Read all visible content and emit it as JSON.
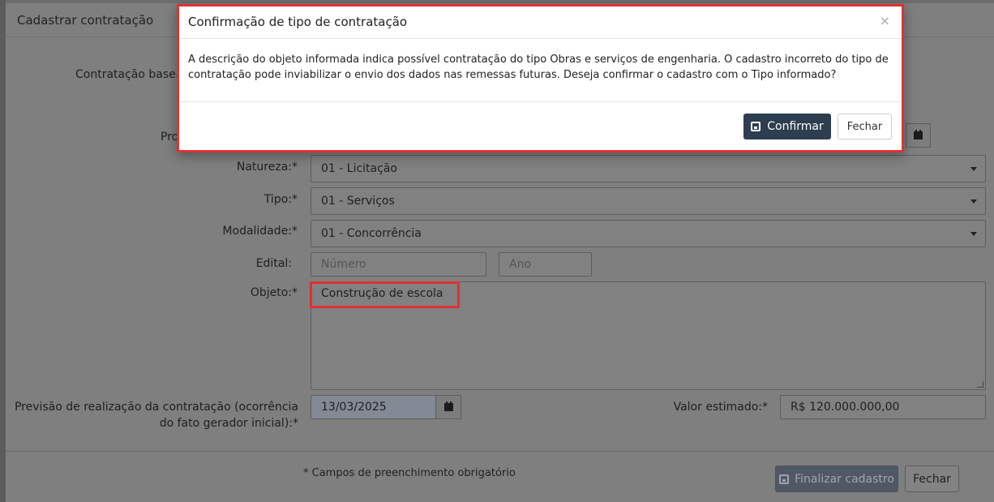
{
  "base_modal": {
    "title": "Cadastrar contratação",
    "labels": {
      "contratacao_baseada": "Contratação basea",
      "processo": "Pro",
      "natureza": "Natureza:*",
      "tipo": "Tipo:*",
      "modalidade": "Modalidade:*",
      "edital": "Edital:",
      "objeto": "Objeto:*",
      "previsao": "Previsão de realização da contratação (ocorrência do fato gerador inicial):*",
      "valor": "Valor estimado:*"
    },
    "fields": {
      "natureza": "01 - Licitação",
      "tipo": "01 - Serviços",
      "modalidade": "01 - Concorrência",
      "edital_numero_placeholder": "Número",
      "edital_ano_placeholder": "Ano",
      "objeto": "Construção de escola",
      "previsao_date": "13/03/2025",
      "valor": "R$ 120.000.000,00"
    },
    "footnote": "* Campos de preenchimento obrigatório",
    "finalizar_label": "Finalizar cadastro",
    "fechar_label": "Fechar"
  },
  "dialog": {
    "title": "Confirmação de tipo de contratação",
    "close_symbol": "×",
    "message": "A descrição do objeto informada indica possível contratação do tipo Obras e serviços de engenharia. O cadastro incorreto do tipo de contratação pode inviabilizar o envio dos dados nas remessas futuras. Deseja confirmar o cadastro com o Tipo informado?",
    "confirm_label": "Confirmar",
    "close_label": "Fechar"
  },
  "colors": {
    "highlight": "#e03131",
    "confirm_button": "#2d3e50"
  }
}
